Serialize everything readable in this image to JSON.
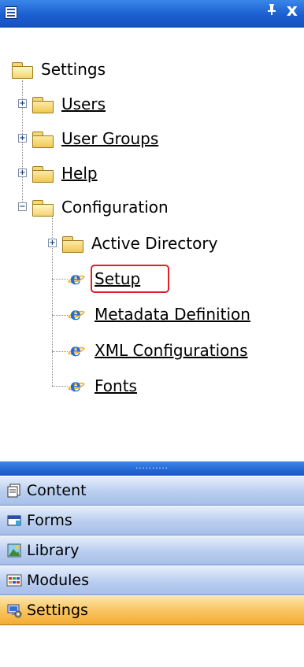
{
  "titlebar": {
    "menu_icon": "list-menu-icon",
    "pin_label": "ᵖ",
    "close_label": "x"
  },
  "tree": {
    "root": {
      "label": "Settings",
      "icon": "folder-open-icon"
    },
    "items": [
      {
        "label": "Users",
        "icon": "folder-icon",
        "expander": "+"
      },
      {
        "label": "User Groups",
        "icon": "folder-icon",
        "expander": "+"
      },
      {
        "label": "Help",
        "icon": "folder-icon",
        "expander": "+"
      },
      {
        "label": "Configuration",
        "icon": "folder-open-icon",
        "expander": "-"
      }
    ],
    "config_children": [
      {
        "label": "Active Directory",
        "icon": "folder-icon",
        "expander": "+"
      },
      {
        "label": "Setup",
        "icon": "ie-page-icon",
        "highlighted": true
      },
      {
        "label": "Metadata Definition",
        "icon": "ie-page-icon"
      },
      {
        "label": "XML Configurations",
        "icon": "ie-page-icon"
      },
      {
        "label": "Fonts",
        "icon": "ie-page-icon"
      }
    ]
  },
  "nav": {
    "grip": "..........",
    "buttons": [
      {
        "label": "Content",
        "icon": "content-icon",
        "active": false
      },
      {
        "label": "Forms",
        "icon": "forms-icon",
        "active": false
      },
      {
        "label": "Library",
        "icon": "library-icon",
        "active": false
      },
      {
        "label": "Modules",
        "icon": "modules-icon",
        "active": false
      },
      {
        "label": "Settings",
        "icon": "settings-icon",
        "active": true
      }
    ]
  },
  "colors": {
    "titlebar": "#1c5fd0",
    "highlight": "#e0202a",
    "nav_active": "#f8c25c",
    "nav_inactive": "#b9cdef"
  }
}
